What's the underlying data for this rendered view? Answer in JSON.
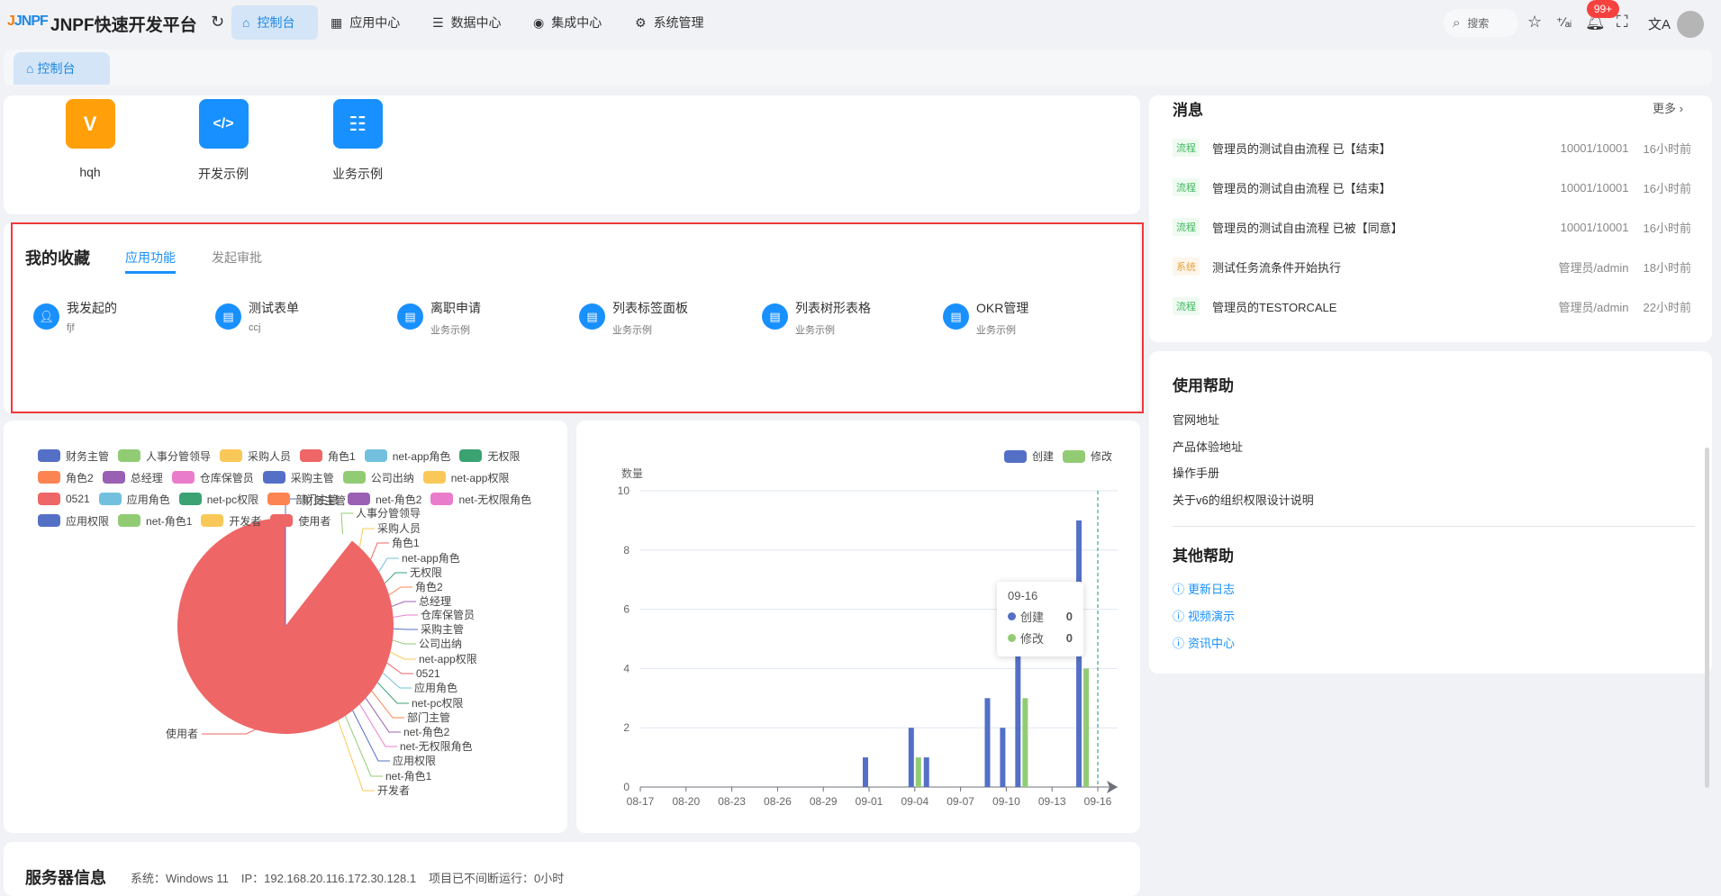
{
  "header": {
    "logo_text": "JNPF",
    "title": "JNPF快速开发平台",
    "nav": [
      {
        "label": "控制台",
        "icon": "home-icon",
        "active": true
      },
      {
        "label": "应用中心",
        "icon": "grid-icon"
      },
      {
        "label": "数据中心",
        "icon": "database-icon"
      },
      {
        "label": "集成中心",
        "icon": "integration-icon"
      },
      {
        "label": "系统管理",
        "icon": "gear-icon"
      }
    ],
    "search_placeholder": "搜索",
    "notification_badge": "99+"
  },
  "tabs": [
    {
      "label": "控制台",
      "icon": "home-icon"
    }
  ],
  "apps": [
    {
      "label": "hqh",
      "color": "#ff9f0a"
    },
    {
      "label": "开发示例",
      "color": "#1890ff"
    },
    {
      "label": "业务示例",
      "color": "#1890ff"
    }
  ],
  "favorites": {
    "title": "我的收藏",
    "tabs": [
      "应用功能",
      "发起审批"
    ],
    "items": [
      {
        "title": "我发起的",
        "sub": "fjf"
      },
      {
        "title": "测试表单",
        "sub": "ccj"
      },
      {
        "title": "离职申请",
        "sub": "业务示例"
      },
      {
        "title": "列表标签面板",
        "sub": "业务示例"
      },
      {
        "title": "列表树形表格",
        "sub": "业务示例"
      },
      {
        "title": "OKR管理",
        "sub": "业务示例"
      }
    ]
  },
  "messages": {
    "title": "消息",
    "more": "更多",
    "items": [
      {
        "tag": "流程",
        "type": "flow",
        "text": "管理员的测试自由流程 已【结束】",
        "source": "10001/10001",
        "time": "16小时前"
      },
      {
        "tag": "流程",
        "type": "flow",
        "text": "管理员的测试自由流程 已【结束】",
        "source": "10001/10001",
        "time": "16小时前"
      },
      {
        "tag": "流程",
        "type": "flow",
        "text": "管理员的测试自由流程 已被【同意】",
        "source": "10001/10001",
        "time": "16小时前"
      },
      {
        "tag": "系统",
        "type": "sys",
        "text": "测试任务流条件开始执行",
        "source": "管理员/admin",
        "time": "18小时前"
      },
      {
        "tag": "流程",
        "type": "flow",
        "text": "管理员的TESTORCALE",
        "source": "管理员/admin",
        "time": "22小时前"
      }
    ]
  },
  "help": {
    "title": "使用帮助",
    "links": [
      "官网地址",
      "产品体验地址",
      "操作手册",
      "关于v6的组织权限设计说明"
    ],
    "other_title": "其他帮助",
    "other_links": [
      "更新日志",
      "视频演示",
      "资讯中心"
    ]
  },
  "server": {
    "title": "服务器信息",
    "os": "系统：Windows 11",
    "ip": "IP：192.168.20.116.172.30.128.1",
    "uptime": "项目已不间断运行：0小时"
  },
  "chart_data": [
    {
      "type": "pie",
      "legend_placement": "top",
      "colors": [
        "#5470c6",
        "#91cc75",
        "#fac858",
        "#ee6666",
        "#73c0de",
        "#3ba272",
        "#fc8452",
        "#9a60b4",
        "#ea7ccc"
      ],
      "labels": [
        "财务主管",
        "人事分管领导",
        "采购人员",
        "角色1",
        "net-app角色",
        "无权限",
        "角色2",
        "总经理",
        "仓库保管员",
        "采购主管",
        "公司出纳",
        "net-app权限",
        "0521",
        "应用角色",
        "net-pc权限",
        "部门主管",
        "net-角色2",
        "net-无权限角色",
        "应用权限",
        "net-角色1",
        "开发者",
        "使用者"
      ],
      "values": [
        0,
        0,
        0,
        0,
        0,
        0,
        0,
        0,
        0,
        0,
        0,
        0,
        0,
        0,
        0,
        0,
        0,
        0,
        0,
        0,
        0,
        1
      ]
    },
    {
      "type": "bar",
      "legend_placement": "top-right",
      "ylabel": "数量",
      "ylim": [
        0,
        10
      ],
      "yticks": [
        0,
        2,
        4,
        6,
        8,
        10
      ],
      "grid": true,
      "categories": [
        "08-17",
        "08-18",
        "08-19",
        "08-20",
        "08-21",
        "08-22",
        "08-23",
        "08-24",
        "08-25",
        "08-26",
        "08-27",
        "08-28",
        "08-29",
        "08-30",
        "08-31",
        "09-01",
        "09-02",
        "09-03",
        "09-04",
        "09-05",
        "09-06",
        "09-07",
        "09-08",
        "09-09",
        "09-10",
        "09-11",
        "09-12",
        "09-13",
        "09-14",
        "09-15",
        "09-16"
      ],
      "tick_labels": [
        "08-17",
        "08-20",
        "08-23",
        "08-26",
        "08-29",
        "09-01",
        "09-04",
        "09-07",
        "09-10",
        "09-13",
        "09-16"
      ],
      "series": [
        {
          "name": "创建",
          "color": "#5470c6",
          "values": [
            0,
            0,
            0,
            0,
            0,
            0,
            0,
            0,
            0,
            0,
            0,
            0,
            0,
            0,
            0,
            1,
            0,
            0,
            2,
            1,
            0,
            0,
            0,
            3,
            2,
            5,
            0,
            0,
            0,
            9,
            0
          ]
        },
        {
          "name": "修改",
          "color": "#91cc75",
          "values": [
            0,
            0,
            0,
            0,
            0,
            0,
            0,
            0,
            0,
            0,
            0,
            0,
            0,
            0,
            0,
            0,
            0,
            0,
            1,
            0,
            0,
            0,
            0,
            0,
            0,
            3,
            0,
            0,
            0,
            4,
            0
          ]
        }
      ],
      "tooltip": {
        "title": "09-16",
        "rows": [
          {
            "name": "创建",
            "value": "0"
          },
          {
            "name": "修改",
            "value": "0"
          }
        ]
      }
    }
  ]
}
